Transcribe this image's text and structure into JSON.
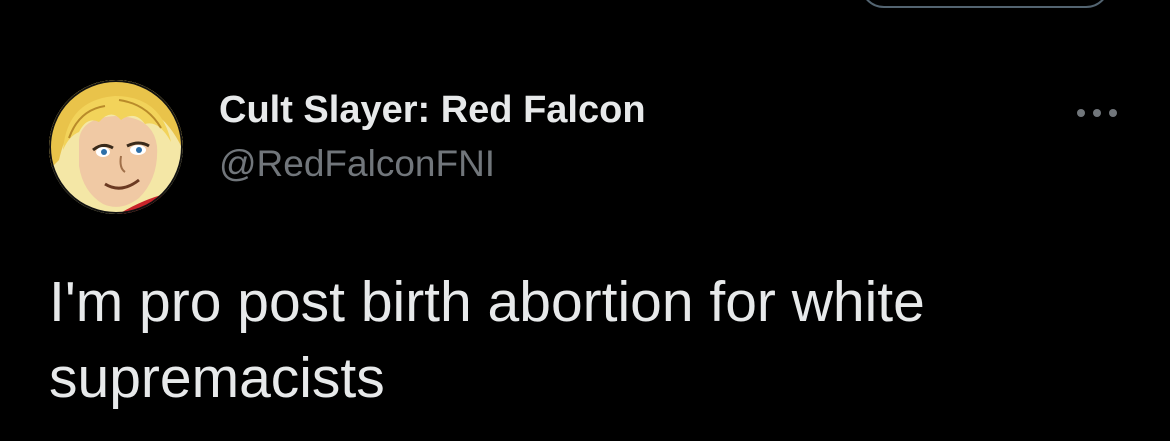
{
  "tweet": {
    "author": {
      "display_name": "Cult Slayer: Red Falcon",
      "handle": "@RedFalconFNI",
      "avatar_icon": "anime-character-avatar"
    },
    "more_icon": "more-options-icon",
    "text": "I'm pro post birth abortion for white supremacists"
  },
  "colors": {
    "background": "#000000",
    "primary_text": "#e7e9ea",
    "secondary_text": "#71767b",
    "border": "#536471"
  }
}
